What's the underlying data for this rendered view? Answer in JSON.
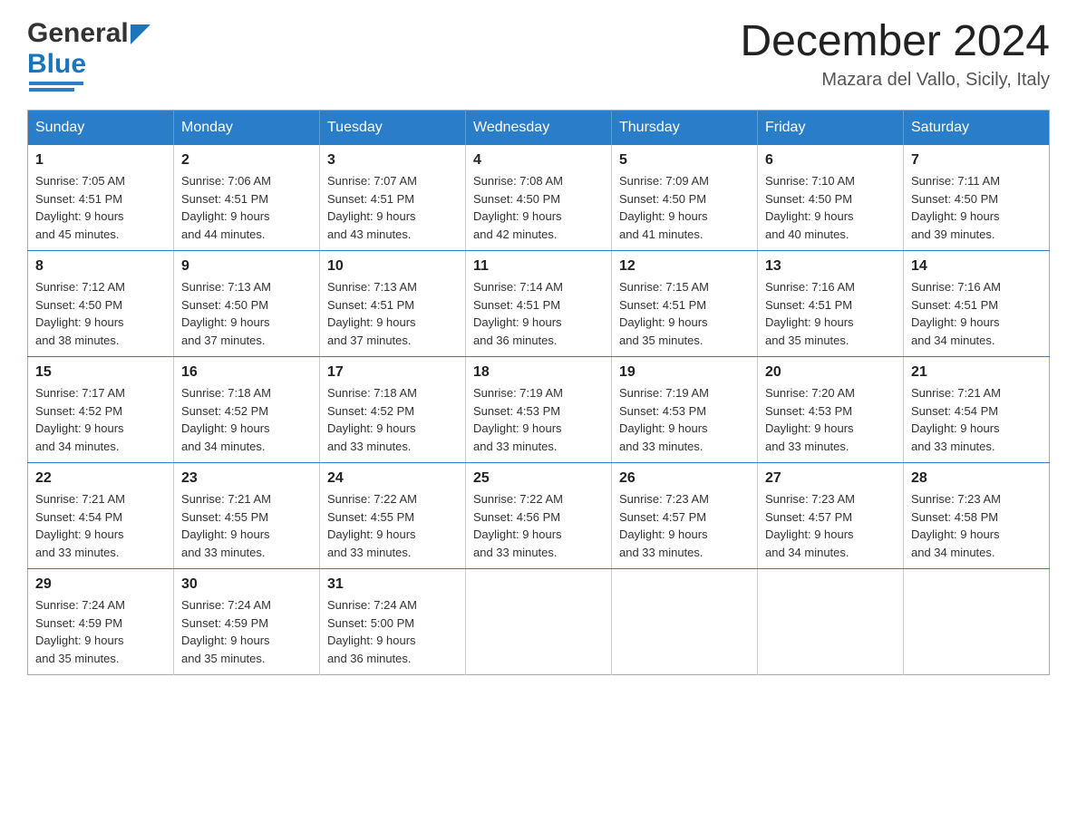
{
  "header": {
    "logo": {
      "general": "General",
      "blue": "Blue"
    },
    "title": "December 2024",
    "location": "Mazara del Vallo, Sicily, Italy"
  },
  "calendar": {
    "days_of_week": [
      "Sunday",
      "Monday",
      "Tuesday",
      "Wednesday",
      "Thursday",
      "Friday",
      "Saturday"
    ],
    "weeks": [
      [
        {
          "day": "1",
          "sunrise": "Sunrise: 7:05 AM",
          "sunset": "Sunset: 4:51 PM",
          "daylight": "Daylight: 9 hours",
          "daylight2": "and 45 minutes."
        },
        {
          "day": "2",
          "sunrise": "Sunrise: 7:06 AM",
          "sunset": "Sunset: 4:51 PM",
          "daylight": "Daylight: 9 hours",
          "daylight2": "and 44 minutes."
        },
        {
          "day": "3",
          "sunrise": "Sunrise: 7:07 AM",
          "sunset": "Sunset: 4:51 PM",
          "daylight": "Daylight: 9 hours",
          "daylight2": "and 43 minutes."
        },
        {
          "day": "4",
          "sunrise": "Sunrise: 7:08 AM",
          "sunset": "Sunset: 4:50 PM",
          "daylight": "Daylight: 9 hours",
          "daylight2": "and 42 minutes."
        },
        {
          "day": "5",
          "sunrise": "Sunrise: 7:09 AM",
          "sunset": "Sunset: 4:50 PM",
          "daylight": "Daylight: 9 hours",
          "daylight2": "and 41 minutes."
        },
        {
          "day": "6",
          "sunrise": "Sunrise: 7:10 AM",
          "sunset": "Sunset: 4:50 PM",
          "daylight": "Daylight: 9 hours",
          "daylight2": "and 40 minutes."
        },
        {
          "day": "7",
          "sunrise": "Sunrise: 7:11 AM",
          "sunset": "Sunset: 4:50 PM",
          "daylight": "Daylight: 9 hours",
          "daylight2": "and 39 minutes."
        }
      ],
      [
        {
          "day": "8",
          "sunrise": "Sunrise: 7:12 AM",
          "sunset": "Sunset: 4:50 PM",
          "daylight": "Daylight: 9 hours",
          "daylight2": "and 38 minutes."
        },
        {
          "day": "9",
          "sunrise": "Sunrise: 7:13 AM",
          "sunset": "Sunset: 4:50 PM",
          "daylight": "Daylight: 9 hours",
          "daylight2": "and 37 minutes."
        },
        {
          "day": "10",
          "sunrise": "Sunrise: 7:13 AM",
          "sunset": "Sunset: 4:51 PM",
          "daylight": "Daylight: 9 hours",
          "daylight2": "and 37 minutes."
        },
        {
          "day": "11",
          "sunrise": "Sunrise: 7:14 AM",
          "sunset": "Sunset: 4:51 PM",
          "daylight": "Daylight: 9 hours",
          "daylight2": "and 36 minutes."
        },
        {
          "day": "12",
          "sunrise": "Sunrise: 7:15 AM",
          "sunset": "Sunset: 4:51 PM",
          "daylight": "Daylight: 9 hours",
          "daylight2": "and 35 minutes."
        },
        {
          "day": "13",
          "sunrise": "Sunrise: 7:16 AM",
          "sunset": "Sunset: 4:51 PM",
          "daylight": "Daylight: 9 hours",
          "daylight2": "and 35 minutes."
        },
        {
          "day": "14",
          "sunrise": "Sunrise: 7:16 AM",
          "sunset": "Sunset: 4:51 PM",
          "daylight": "Daylight: 9 hours",
          "daylight2": "and 34 minutes."
        }
      ],
      [
        {
          "day": "15",
          "sunrise": "Sunrise: 7:17 AM",
          "sunset": "Sunset: 4:52 PM",
          "daylight": "Daylight: 9 hours",
          "daylight2": "and 34 minutes."
        },
        {
          "day": "16",
          "sunrise": "Sunrise: 7:18 AM",
          "sunset": "Sunset: 4:52 PM",
          "daylight": "Daylight: 9 hours",
          "daylight2": "and 34 minutes."
        },
        {
          "day": "17",
          "sunrise": "Sunrise: 7:18 AM",
          "sunset": "Sunset: 4:52 PM",
          "daylight": "Daylight: 9 hours",
          "daylight2": "and 33 minutes."
        },
        {
          "day": "18",
          "sunrise": "Sunrise: 7:19 AM",
          "sunset": "Sunset: 4:53 PM",
          "daylight": "Daylight: 9 hours",
          "daylight2": "and 33 minutes."
        },
        {
          "day": "19",
          "sunrise": "Sunrise: 7:19 AM",
          "sunset": "Sunset: 4:53 PM",
          "daylight": "Daylight: 9 hours",
          "daylight2": "and 33 minutes."
        },
        {
          "day": "20",
          "sunrise": "Sunrise: 7:20 AM",
          "sunset": "Sunset: 4:53 PM",
          "daylight": "Daylight: 9 hours",
          "daylight2": "and 33 minutes."
        },
        {
          "day": "21",
          "sunrise": "Sunrise: 7:21 AM",
          "sunset": "Sunset: 4:54 PM",
          "daylight": "Daylight: 9 hours",
          "daylight2": "and 33 minutes."
        }
      ],
      [
        {
          "day": "22",
          "sunrise": "Sunrise: 7:21 AM",
          "sunset": "Sunset: 4:54 PM",
          "daylight": "Daylight: 9 hours",
          "daylight2": "and 33 minutes."
        },
        {
          "day": "23",
          "sunrise": "Sunrise: 7:21 AM",
          "sunset": "Sunset: 4:55 PM",
          "daylight": "Daylight: 9 hours",
          "daylight2": "and 33 minutes."
        },
        {
          "day": "24",
          "sunrise": "Sunrise: 7:22 AM",
          "sunset": "Sunset: 4:55 PM",
          "daylight": "Daylight: 9 hours",
          "daylight2": "and 33 minutes."
        },
        {
          "day": "25",
          "sunrise": "Sunrise: 7:22 AM",
          "sunset": "Sunset: 4:56 PM",
          "daylight": "Daylight: 9 hours",
          "daylight2": "and 33 minutes."
        },
        {
          "day": "26",
          "sunrise": "Sunrise: 7:23 AM",
          "sunset": "Sunset: 4:57 PM",
          "daylight": "Daylight: 9 hours",
          "daylight2": "and 33 minutes."
        },
        {
          "day": "27",
          "sunrise": "Sunrise: 7:23 AM",
          "sunset": "Sunset: 4:57 PM",
          "daylight": "Daylight: 9 hours",
          "daylight2": "and 34 minutes."
        },
        {
          "day": "28",
          "sunrise": "Sunrise: 7:23 AM",
          "sunset": "Sunset: 4:58 PM",
          "daylight": "Daylight: 9 hours",
          "daylight2": "and 34 minutes."
        }
      ],
      [
        {
          "day": "29",
          "sunrise": "Sunrise: 7:24 AM",
          "sunset": "Sunset: 4:59 PM",
          "daylight": "Daylight: 9 hours",
          "daylight2": "and 35 minutes."
        },
        {
          "day": "30",
          "sunrise": "Sunrise: 7:24 AM",
          "sunset": "Sunset: 4:59 PM",
          "daylight": "Daylight: 9 hours",
          "daylight2": "and 35 minutes."
        },
        {
          "day": "31",
          "sunrise": "Sunrise: 7:24 AM",
          "sunset": "Sunset: 5:00 PM",
          "daylight": "Daylight: 9 hours",
          "daylight2": "and 36 minutes."
        },
        {
          "day": "",
          "sunrise": "",
          "sunset": "",
          "daylight": "",
          "daylight2": ""
        },
        {
          "day": "",
          "sunrise": "",
          "sunset": "",
          "daylight": "",
          "daylight2": ""
        },
        {
          "day": "",
          "sunrise": "",
          "sunset": "",
          "daylight": "",
          "daylight2": ""
        },
        {
          "day": "",
          "sunrise": "",
          "sunset": "",
          "daylight": "",
          "daylight2": ""
        }
      ]
    ]
  }
}
